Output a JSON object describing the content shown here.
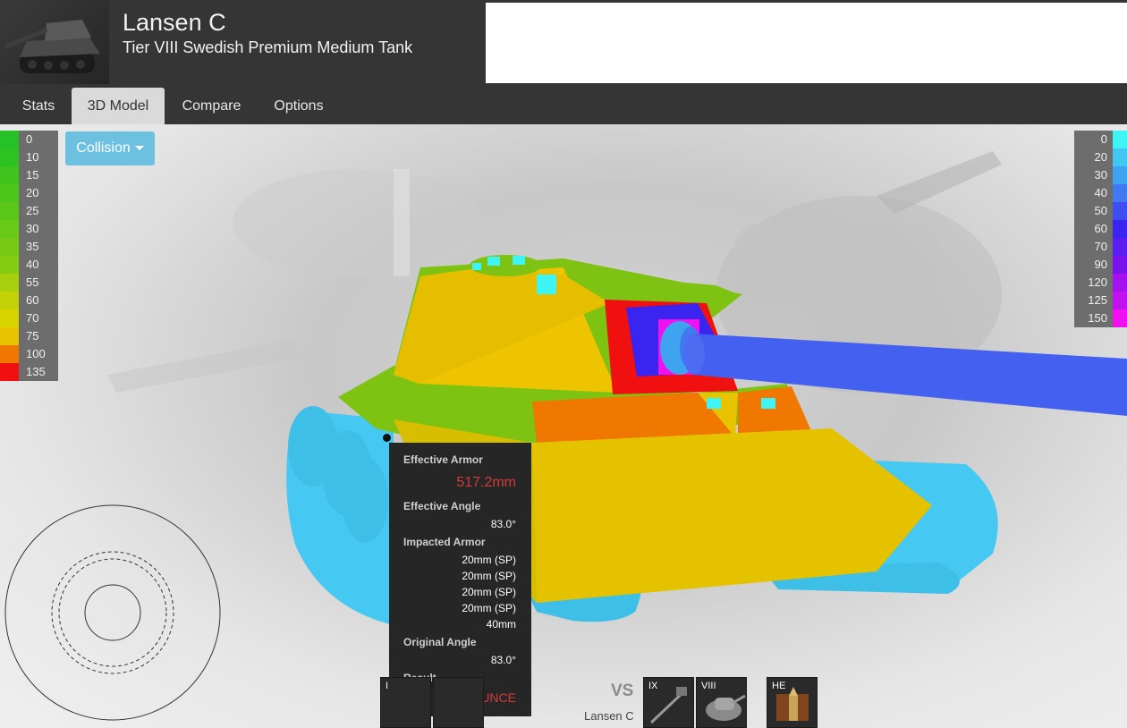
{
  "header": {
    "title": "Lansen C",
    "subtitle": "Tier VIII Swedish Premium Medium Tank"
  },
  "tabs": [
    {
      "label": "Stats",
      "active": false
    },
    {
      "label": "3D Model",
      "active": true
    },
    {
      "label": "Compare",
      "active": false
    },
    {
      "label": "Options",
      "active": false
    }
  ],
  "collision_button": {
    "label": "Collision"
  },
  "legend_left": [
    {
      "label": "0",
      "color": "#26c126"
    },
    {
      "label": "10",
      "color": "#2cc21f"
    },
    {
      "label": "15",
      "color": "#3ec41d"
    },
    {
      "label": "20",
      "color": "#4cc61b"
    },
    {
      "label": "25",
      "color": "#5ac719"
    },
    {
      "label": "30",
      "color": "#68c917"
    },
    {
      "label": "35",
      "color": "#77ca14"
    },
    {
      "label": "40",
      "color": "#86cc12"
    },
    {
      "label": "55",
      "color": "#a8cf0c"
    },
    {
      "label": "60",
      "color": "#c2d207"
    },
    {
      "label": "70",
      "color": "#d8d400"
    },
    {
      "label": "75",
      "color": "#e8c400"
    },
    {
      "label": "100",
      "color": "#f07800"
    },
    {
      "label": "135",
      "color": "#f01010"
    }
  ],
  "legend_right": [
    {
      "label": "0",
      "color": "#3ff4f4"
    },
    {
      "label": "20",
      "color": "#42c6f2"
    },
    {
      "label": "30",
      "color": "#3fa4f0"
    },
    {
      "label": "40",
      "color": "#4379f0"
    },
    {
      "label": "50",
      "color": "#3f4ef2"
    },
    {
      "label": "60",
      "color": "#3a24f0"
    },
    {
      "label": "70",
      "color": "#5a1ef0"
    },
    {
      "label": "90",
      "color": "#7a12ee"
    },
    {
      "label": "120",
      "color": "#a412f0"
    },
    {
      "label": "125",
      "color": "#c212f0"
    },
    {
      "label": "150",
      "color": "#f010f0"
    }
  ],
  "tooltip": {
    "effective_armor_label": "Effective Armor",
    "effective_armor_value": "517.2mm",
    "effective_angle_label": "Effective Angle",
    "effective_angle_value": "83.0°",
    "impacted_armor_label": "Impacted Armor",
    "impacted_armor_values": [
      "20mm (SP)",
      "20mm (SP)",
      "20mm (SP)",
      "20mm (SP)",
      "40mm"
    ],
    "original_angle_label": "Original Angle",
    "original_angle_value": "83.0°",
    "result_label": "Result",
    "result_value": "BOUNCE"
  },
  "compare": {
    "vs_label": "VS",
    "tank_name": "Lansen C",
    "slots": [
      {
        "tier": "I",
        "name": "player-gun-slot"
      },
      {
        "tier": "",
        "name": "player-module-slot"
      },
      {
        "tier": "IX",
        "name": "enemy-gun-slot"
      },
      {
        "tier": "VIII",
        "name": "enemy-turret-slot"
      },
      {
        "tier": "HE",
        "name": "ammo-he-slot"
      }
    ]
  },
  "colors": {
    "header_bg": "#353535",
    "active_tab_bg": "#dadada",
    "button_blue": "#6cc0e0",
    "tooltip_bg": "#262626",
    "result_red": "#d43a3a"
  }
}
